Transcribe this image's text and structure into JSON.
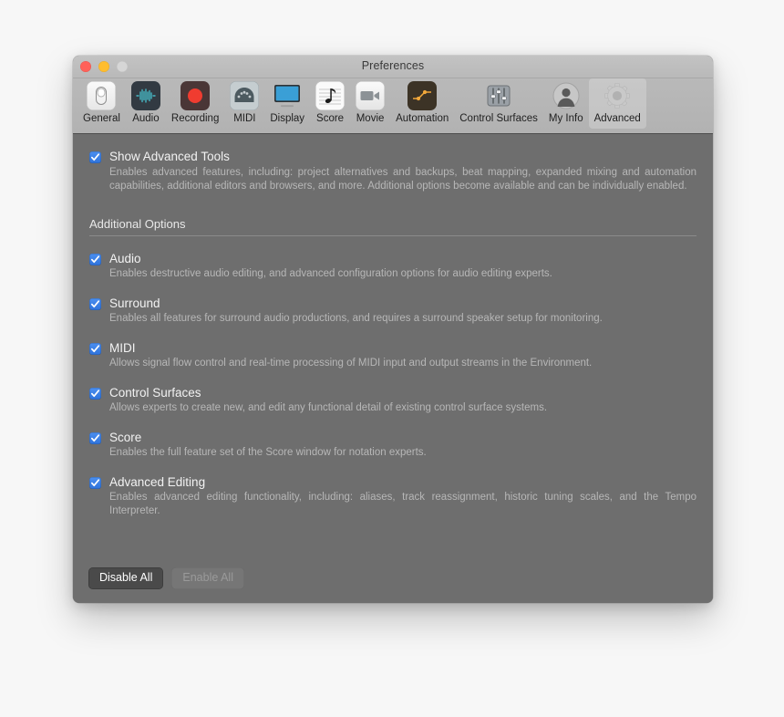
{
  "window": {
    "title": "Preferences",
    "traffic_lights": [
      {
        "name": "close",
        "color": "#ff6159"
      },
      {
        "name": "minimize",
        "color": "#ffbd2e"
      },
      {
        "name": "zoom",
        "color": "#d6d6d6"
      }
    ]
  },
  "toolbar": {
    "tabs": [
      {
        "label": "General",
        "icon": "toggle-switch-icon",
        "selected": false
      },
      {
        "label": "Audio",
        "icon": "waveform-icon",
        "selected": false
      },
      {
        "label": "Recording",
        "icon": "record-circle-icon",
        "selected": false
      },
      {
        "label": "MIDI",
        "icon": "midi-connector-icon",
        "selected": false
      },
      {
        "label": "Display",
        "icon": "monitor-icon",
        "selected": false
      },
      {
        "label": "Score",
        "icon": "music-note-icon",
        "selected": false
      },
      {
        "label": "Movie",
        "icon": "video-camera-icon",
        "selected": false
      },
      {
        "label": "Automation",
        "icon": "automation-curve-icon",
        "selected": false
      },
      {
        "label": "Control Surfaces",
        "icon": "faders-icon",
        "selected": false
      },
      {
        "label": "My Info",
        "icon": "user-avatar-icon",
        "selected": false
      },
      {
        "label": "Advanced",
        "icon": "gear-icon",
        "selected": true
      }
    ]
  },
  "main": {
    "advanced_tools": {
      "label": "Show Advanced Tools",
      "checked": true,
      "description": "Enables advanced features, including: project alternatives and backups, beat mapping, expanded mixing and automation capabilities, additional editors and browsers, and more. Additional options become available and can be individually enabled."
    },
    "section_header": "Additional Options",
    "options": [
      {
        "label": "Audio",
        "checked": true,
        "description": "Enables destructive audio editing, and advanced configuration options for audio editing experts."
      },
      {
        "label": "Surround",
        "checked": true,
        "description": "Enables all features for surround audio productions, and requires a surround speaker setup for monitoring."
      },
      {
        "label": "MIDI",
        "checked": true,
        "description": "Allows signal flow control and real-time processing of MIDI input and output streams in the Environment."
      },
      {
        "label": "Control Surfaces",
        "checked": true,
        "description": "Allows experts to create new, and edit any functional detail of existing control surface systems."
      },
      {
        "label": "Score",
        "checked": true,
        "description": "Enables the full feature set of the Score window for notation experts."
      },
      {
        "label": "Advanced Editing",
        "checked": true,
        "description": "Enables advanced editing functionality, including: aliases, track reassignment, historic tuning scales, and the Tempo Interpreter."
      }
    ],
    "buttons": {
      "disable_all": {
        "label": "Disable All",
        "enabled": true
      },
      "enable_all": {
        "label": "Enable All",
        "enabled": false
      }
    }
  },
  "colors": {
    "checkbox_blue": "#3d7fe8",
    "window_body": "#6e6e6e",
    "toolbar": "#b5b5b5",
    "title_bar": "#bdbdbd"
  }
}
